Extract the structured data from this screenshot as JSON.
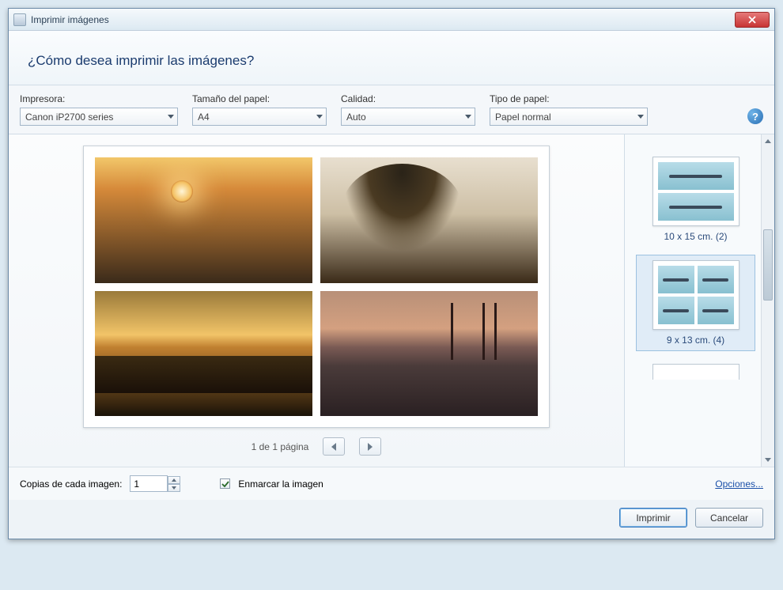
{
  "window": {
    "title": "Imprimir imágenes"
  },
  "header": {
    "question": "¿Cómo desea imprimir las imágenes?"
  },
  "options": {
    "printer_label": "Impresora:",
    "printer_value": "Canon iP2700 series",
    "paper_size_label": "Tamaño del papel:",
    "paper_size_value": "A4",
    "quality_label": "Calidad:",
    "quality_value": "Auto",
    "paper_type_label": "Tipo de papel:",
    "paper_type_value": "Papel normal"
  },
  "pager": {
    "text": "1 de 1 página"
  },
  "layouts": {
    "top_caption": "",
    "items": [
      {
        "caption": "10 x 15 cm. (2)",
        "selected": false,
        "grid": "two"
      },
      {
        "caption": "9 x 13 cm. (4)",
        "selected": true,
        "grid": "four"
      }
    ]
  },
  "footer": {
    "copies_label": "Copias de cada imagen:",
    "copies_value": "1",
    "fit_label": "Enmarcar la imagen",
    "fit_checked": true,
    "options_link": "Opciones..."
  },
  "buttons": {
    "print": "Imprimir",
    "cancel": "Cancelar"
  }
}
